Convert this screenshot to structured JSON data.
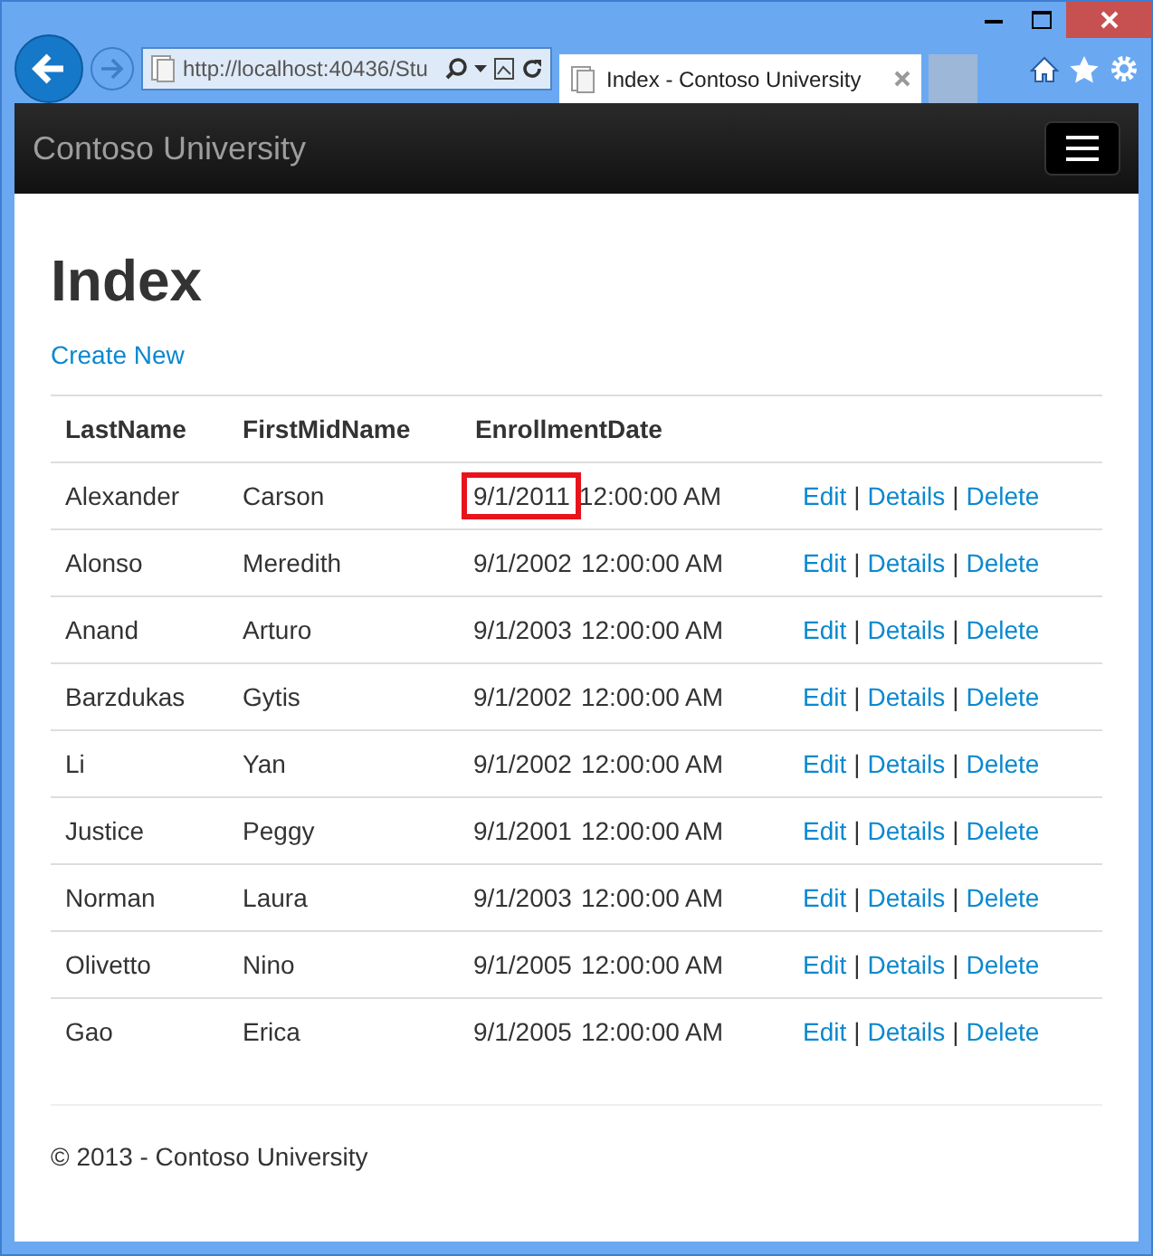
{
  "browser": {
    "address": "http://localhost:40436/Stu",
    "tab": {
      "title": "Index - Contoso University",
      "selected": true
    }
  },
  "navbar": {
    "brand": "Contoso University"
  },
  "page": {
    "heading": "Index",
    "create_link": "Create New"
  },
  "table": {
    "columns": [
      "LastName",
      "FirstMidName",
      "EnrollmentDate"
    ],
    "rows": [
      {
        "last": "Alexander",
        "first": "Carson",
        "date": "9/1/2011",
        "time": "12:00:00 AM",
        "highlighted": true,
        "actions": [
          {
            "kind": "link",
            "text": "Edit"
          },
          {
            "kind": "separator",
            "text": "|"
          },
          {
            "kind": "link",
            "text": "Details"
          },
          {
            "kind": "separator",
            "text": "|"
          },
          {
            "kind": "link",
            "text": "Delete"
          }
        ]
      },
      {
        "last": "Alonso",
        "first": "Meredith",
        "date": "9/1/2002",
        "time": "12:00:00 AM",
        "highlighted": false,
        "actions": [
          {
            "kind": "link",
            "text": "Edit"
          },
          {
            "kind": "separator",
            "text": "|"
          },
          {
            "kind": "link",
            "text": "Details"
          },
          {
            "kind": "separator",
            "text": "|"
          },
          {
            "kind": "link",
            "text": "Delete"
          }
        ]
      },
      {
        "last": "Anand",
        "first": "Arturo",
        "date": "9/1/2003",
        "time": "12:00:00 AM",
        "highlighted": false,
        "actions": [
          {
            "kind": "link",
            "text": "Edit"
          },
          {
            "kind": "separator",
            "text": "|"
          },
          {
            "kind": "link",
            "text": "Details"
          },
          {
            "kind": "separator",
            "text": "|"
          },
          {
            "kind": "link",
            "text": "Delete"
          }
        ]
      },
      {
        "last": "Barzdukas",
        "first": "Gytis",
        "date": "9/1/2002",
        "time": "12:00:00 AM",
        "highlighted": false,
        "actions": [
          {
            "kind": "link",
            "text": "Edit"
          },
          {
            "kind": "separator",
            "text": "|"
          },
          {
            "kind": "link",
            "text": "Details"
          },
          {
            "kind": "separator",
            "text": "|"
          },
          {
            "kind": "link",
            "text": "Delete"
          }
        ]
      },
      {
        "last": "Li",
        "first": "Yan",
        "date": "9/1/2002",
        "time": "12:00:00 AM",
        "highlighted": false,
        "actions": [
          {
            "kind": "link",
            "text": "Edit"
          },
          {
            "kind": "separator",
            "text": "|"
          },
          {
            "kind": "link",
            "text": "Details"
          },
          {
            "kind": "separator",
            "text": "|"
          },
          {
            "kind": "link",
            "text": "Delete"
          }
        ]
      },
      {
        "last": "Justice",
        "first": "Peggy",
        "date": "9/1/2001",
        "time": "12:00:00 AM",
        "highlighted": false,
        "actions": [
          {
            "kind": "link",
            "text": "Edit"
          },
          {
            "kind": "separator",
            "text": "|"
          },
          {
            "kind": "link",
            "text": "Details"
          },
          {
            "kind": "separator",
            "text": "|"
          },
          {
            "kind": "link",
            "text": "Delete"
          }
        ]
      },
      {
        "last": "Norman",
        "first": "Laura",
        "date": "9/1/2003",
        "time": "12:00:00 AM",
        "highlighted": false,
        "actions": [
          {
            "kind": "link",
            "text": "Edit"
          },
          {
            "kind": "separator",
            "text": "|"
          },
          {
            "kind": "link",
            "text": "Details"
          },
          {
            "kind": "separator",
            "text": "|"
          },
          {
            "kind": "link",
            "text": "Delete"
          }
        ]
      },
      {
        "last": "Olivetto",
        "first": "Nino",
        "date": "9/1/2005",
        "time": "12:00:00 AM",
        "highlighted": false,
        "actions": [
          {
            "kind": "link",
            "text": "Edit"
          },
          {
            "kind": "separator",
            "text": "|"
          },
          {
            "kind": "link",
            "text": "Details"
          },
          {
            "kind": "separator",
            "text": "|"
          },
          {
            "kind": "link",
            "text": "Delete"
          }
        ]
      },
      {
        "last": "Gao",
        "first": "Erica",
        "date": "9/1/2005",
        "time": "12:00:00 AM",
        "highlighted": false,
        "actions": [
          {
            "kind": "link",
            "text": "Edit"
          },
          {
            "kind": "separator",
            "text": "|"
          },
          {
            "kind": "link",
            "text": "Details"
          },
          {
            "kind": "separator",
            "text": "|"
          },
          {
            "kind": "link",
            "text": "Delete"
          }
        ]
      }
    ]
  },
  "footer": "© 2013 - Contoso University"
}
